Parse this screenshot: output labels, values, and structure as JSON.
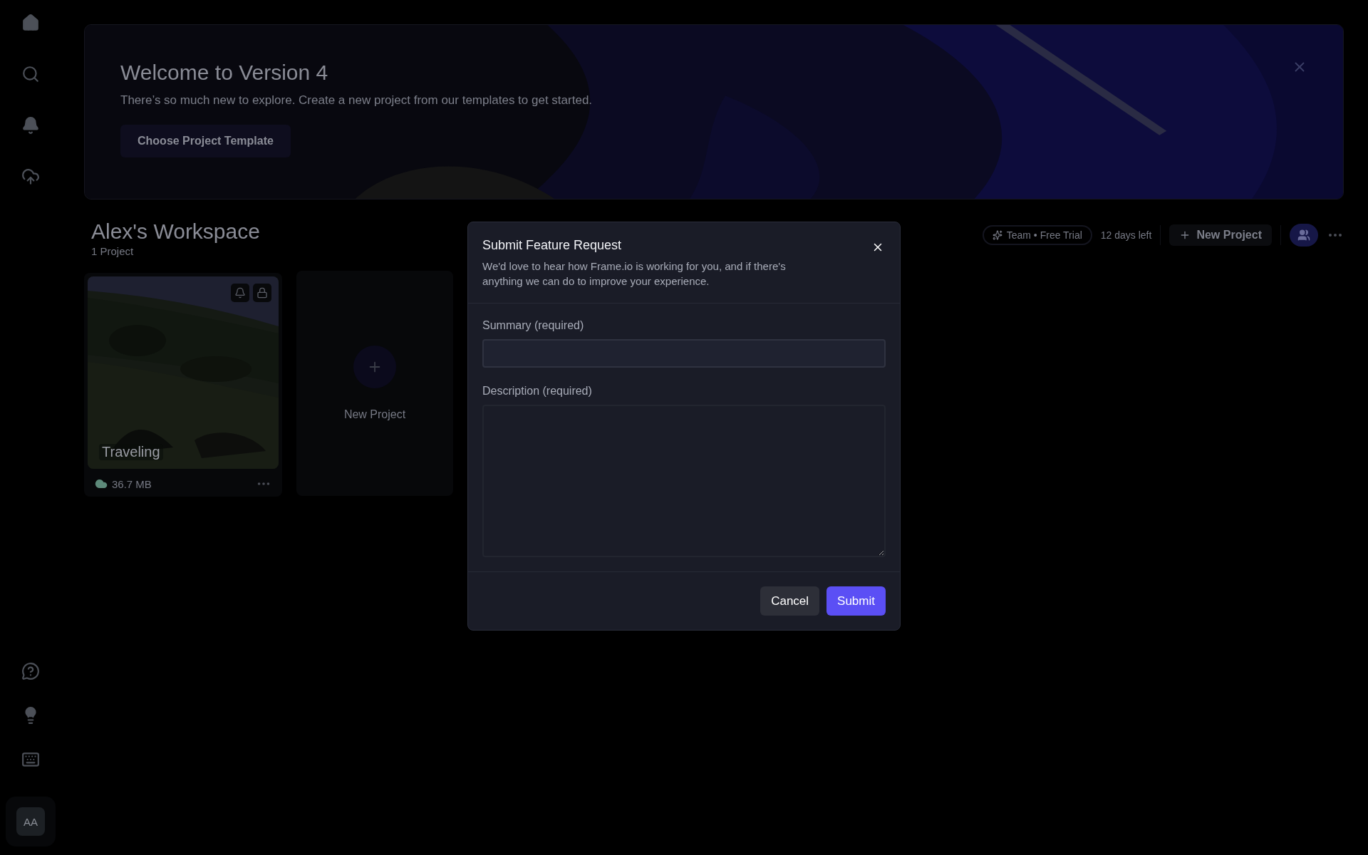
{
  "sidebar": {
    "avatar_initials": "AA"
  },
  "banner": {
    "title": "Welcome to Version 4",
    "subtitle": "There’s so much new to explore. Create a new project from our templates to get started.",
    "button": "Choose Project Template"
  },
  "workspace": {
    "title": "Alex's Workspace",
    "project_count": "1 Project",
    "plan_badge": "Team • Free Trial",
    "trial_remaining": "12 days left",
    "new_project_button": "New Project"
  },
  "projects": [
    {
      "kind": "project",
      "name": "Traveling",
      "size": "36.7 MB"
    },
    {
      "kind": "new",
      "label": "New Project"
    }
  ],
  "dialog": {
    "title": "Submit Feature Request",
    "description": "We'd love to hear how Frame.io is working for you, and if there's anything we can do to improve your experience.",
    "fields": [
      {
        "kind": "text",
        "label": "Summary (required)"
      },
      {
        "kind": "textarea",
        "label": "Description (required)"
      }
    ],
    "buttons": [
      {
        "kind": "secondary",
        "label": "Cancel"
      },
      {
        "kind": "primary",
        "label": "Submit"
      }
    ]
  }
}
